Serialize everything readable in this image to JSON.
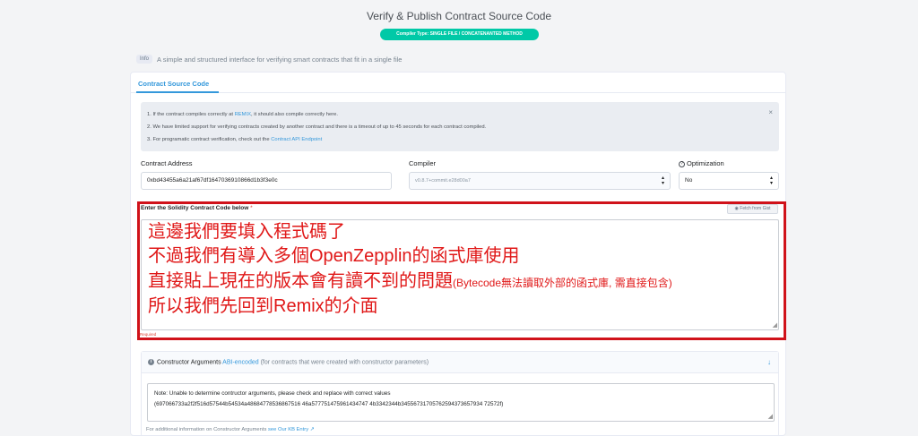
{
  "header": {
    "title": "Verify & Publish Contract Source Code",
    "compiler_type": "Compiler Type: SINGLE FILE / CONCATENANTED METHOD"
  },
  "info": {
    "tag": "Info",
    "text": "A simple and structured interface for verifying smart contracts that fit in a single file"
  },
  "tabs": [
    {
      "label": "Contract Source Code",
      "active": true
    }
  ],
  "alert": {
    "line1_pre": "1. If the contract compiles correctly at ",
    "line1_link": "REMIX",
    "line1_post": ", it should also compile correctly here.",
    "line2": "2. We have limited support for verifying contracts created by another contract and there is a timeout of up to 45 seconds for each contract compiled.",
    "line3_pre": "3. For programatic contract verification, check out the ",
    "line3_link": "Contract API Endpoint",
    "close": "×"
  },
  "form": {
    "address_label": "Contract Address",
    "address_value": "0xbd43455a6a21af67df1647036910866d1b3f3e0c",
    "compiler_label": "Compiler",
    "compiler_value": "v0.8.7+commit.e28d00a7",
    "optimization_label": "Optimization",
    "optimization_value": "No"
  },
  "code": {
    "label": "Enter the Solidity Contract Code below",
    "required_mark": "*",
    "fetch_button": "Fetch from Gist",
    "line1": "這邊我們要填入程式碼了",
    "line2": "不過我們有導入多個OpenZepplin的函式庫使用",
    "line3_main": "直接貼上現在的版本會有讀不到的問題",
    "line3_small": "(Bytecode無法讀取外部的函式庫, 需直接包含)",
    "line4": "所以我們先回到Remix的介面",
    "required_text": "Required"
  },
  "constructor": {
    "title": "Constructor Arguments",
    "link": "ABI-encoded",
    "note": "(for contracts that were created with constructor parameters)",
    "text_line1": "Note: Unable to determine contructor arguments, please check and replace with correct values",
    "text_line2": "(697066733a2f2f516d57544b54534a48684778536867516 46a577751475961434747 4b3342344b34556731705762594373657934 72572f)",
    "footer_pre": "For additional information on Constructor Arguments ",
    "footer_link": "see Our KB Entry"
  },
  "colors": {
    "accent": "#3498db",
    "pill": "#00c9a7",
    "annotation_red": "#e01818",
    "frame_red": "#d0121a"
  },
  "icons": [
    "close-icon",
    "help-circle-icon",
    "sort-arrows-icon",
    "github-icon",
    "info-circle-icon",
    "chevron-down-icon",
    "external-link-icon",
    "resize-grip-icon"
  ]
}
